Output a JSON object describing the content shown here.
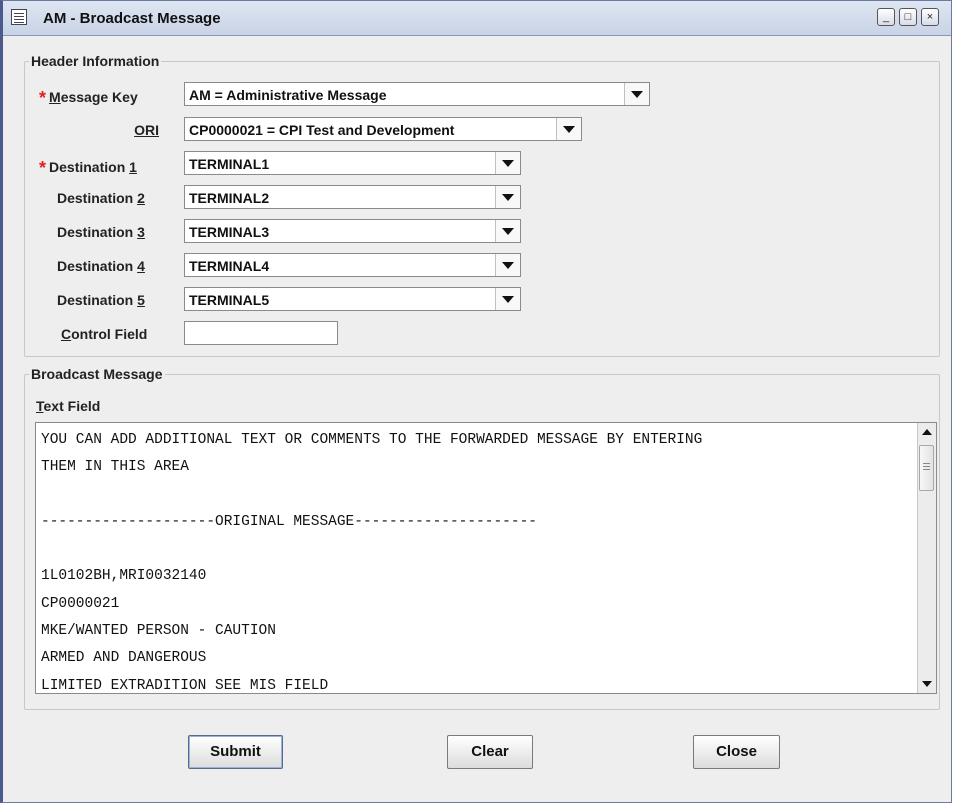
{
  "window": {
    "title": "AM - Broadcast Message",
    "controls": {
      "minimize_icon": "minimize-icon",
      "maximize_icon": "maximize-icon",
      "close_icon": "close-icon"
    }
  },
  "header_section": {
    "title": "Header Information",
    "fields": {
      "message_key": {
        "label_pre": "",
        "label_mnemonic": "M",
        "label_post": "essage Key",
        "required": true,
        "value": "AM = Administrative Message"
      },
      "ori": {
        "label_pre": "",
        "label_mnemonic": "ORI",
        "label_post": "",
        "required": false,
        "value": "CP0000021 = CPI Test and Development"
      },
      "destination_1": {
        "label_pre": "Destination ",
        "label_mnemonic": "1",
        "label_post": "",
        "required": true,
        "value": "TERMINAL1"
      },
      "destination_2": {
        "label_pre": "Destination ",
        "label_mnemonic": "2",
        "label_post": "",
        "required": false,
        "value": "TERMINAL2"
      },
      "destination_3": {
        "label_pre": "Destination ",
        "label_mnemonic": "3",
        "label_post": "",
        "required": false,
        "value": "TERMINAL3"
      },
      "destination_4": {
        "label_pre": "Destination ",
        "label_mnemonic": "4",
        "label_post": "",
        "required": false,
        "value": "TERMINAL4"
      },
      "destination_5": {
        "label_pre": "Destination ",
        "label_mnemonic": "5",
        "label_post": "",
        "required": false,
        "value": "TERMINAL5"
      },
      "control_field": {
        "label_pre": "",
        "label_mnemonic": "C",
        "label_post": "ontrol Field",
        "required": false,
        "value": ""
      }
    },
    "required_marker": "*"
  },
  "broadcast_section": {
    "title": "Broadcast Message",
    "text_field_label_mnemonic": "T",
    "text_field_label_rest": "ext Field",
    "lines": [
      "YOU CAN ADD ADDITIONAL TEXT OR COMMENTS TO THE FORWARDED MESSAGE BY ENTERING",
      "THEM IN THIS AREA",
      "",
      "--------------------ORIGINAL MESSAGE---------------------",
      "",
      "1L0102BH,MRI0032140",
      "CP0000021",
      "MKE/WANTED PERSON - CAUTION",
      "ARMED AND DANGEROUS",
      "LIMITED EXTRADITION SEE MIS FIELD"
    ]
  },
  "buttons": {
    "submit": "Submit",
    "clear": "Clear",
    "close": "Close"
  },
  "colors": {
    "required_asterisk": "#e02020",
    "window_background": "#eeeeee",
    "title_bar": "#c8d3e6"
  }
}
